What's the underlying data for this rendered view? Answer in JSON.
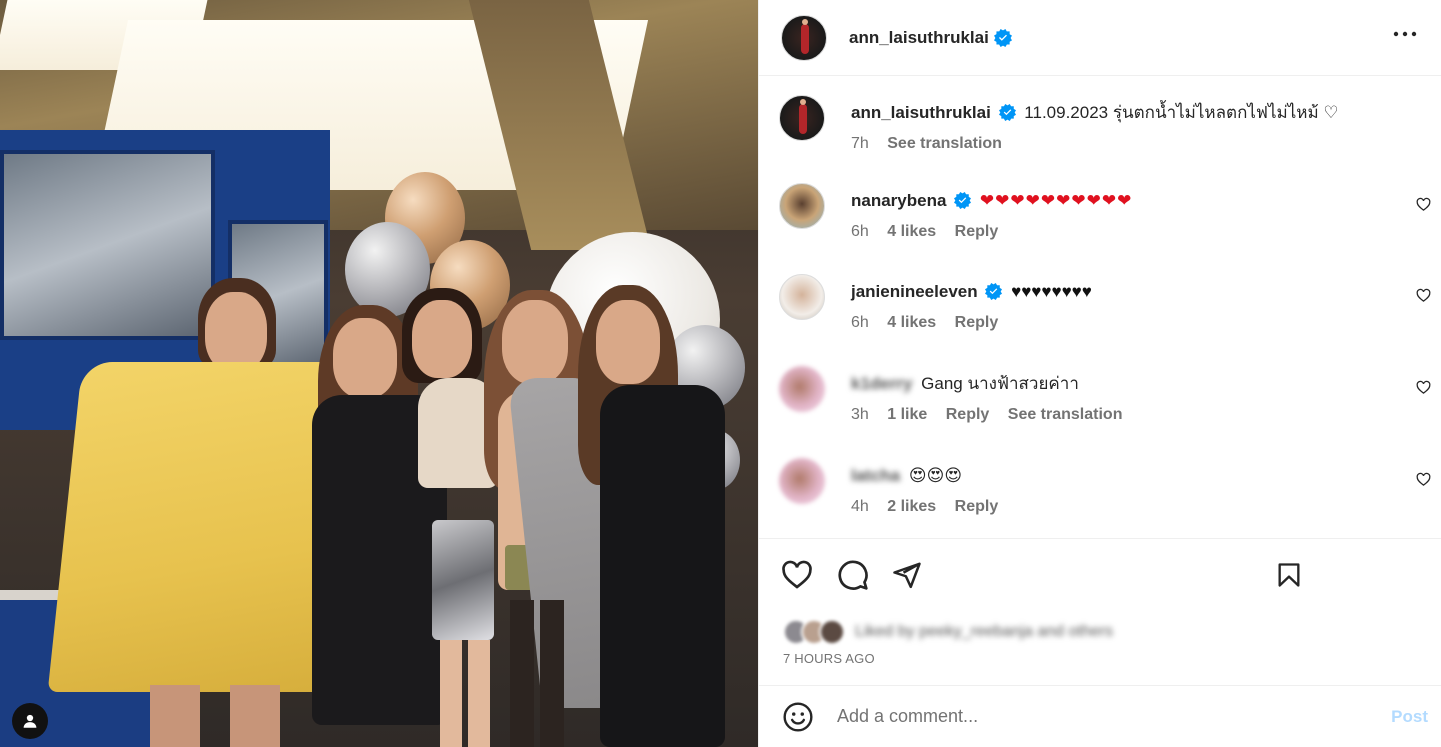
{
  "post": {
    "author": "ann_laisuthruklai",
    "caption_date": "11.09.2023",
    "caption_text": "รุ่นตกน้ำไม่ไหลตกไฟไม่ไหม้ ♡",
    "caption_time": "7h",
    "see_translation": "See translation",
    "time_ago": "7 HOURS AGO",
    "liked_by": "Liked by peeky_reebanja and others"
  },
  "comments": [
    {
      "user": "nanarybena",
      "verified": true,
      "text": "❤❤❤❤❤❤❤❤❤❤",
      "time": "6h",
      "likes": "4 likes",
      "reply": "Reply"
    },
    {
      "user": "janienineeleven",
      "verified": true,
      "text": "♥♥♥♥♥♥♥♥",
      "time": "6h",
      "likes": "4 likes",
      "reply": "Reply"
    },
    {
      "user": "k1derry",
      "verified": false,
      "text": "Gang นางฟ้าสวยค่าา",
      "time": "3h",
      "likes": "1 like",
      "reply": "Reply",
      "translate": "See translation"
    },
    {
      "user": "latcha",
      "verified": false,
      "text": "😍😍😍",
      "time": "4h",
      "likes": "2 likes",
      "reply": "Reply"
    }
  ],
  "add_comment": {
    "placeholder": "Add a comment...",
    "post_label": "Post"
  },
  "icons": {
    "more": "more-options-icon",
    "like": "heart-icon",
    "comment": "comment-icon",
    "share": "share-icon",
    "save": "bookmark-icon",
    "emoji": "emoji-icon",
    "verified": "verified-badge-icon",
    "tag": "user-tag-icon"
  },
  "colors": {
    "verified": "#0095f6",
    "post_disabled": "#b3dbff",
    "muted": "#737373",
    "text": "#262626"
  }
}
